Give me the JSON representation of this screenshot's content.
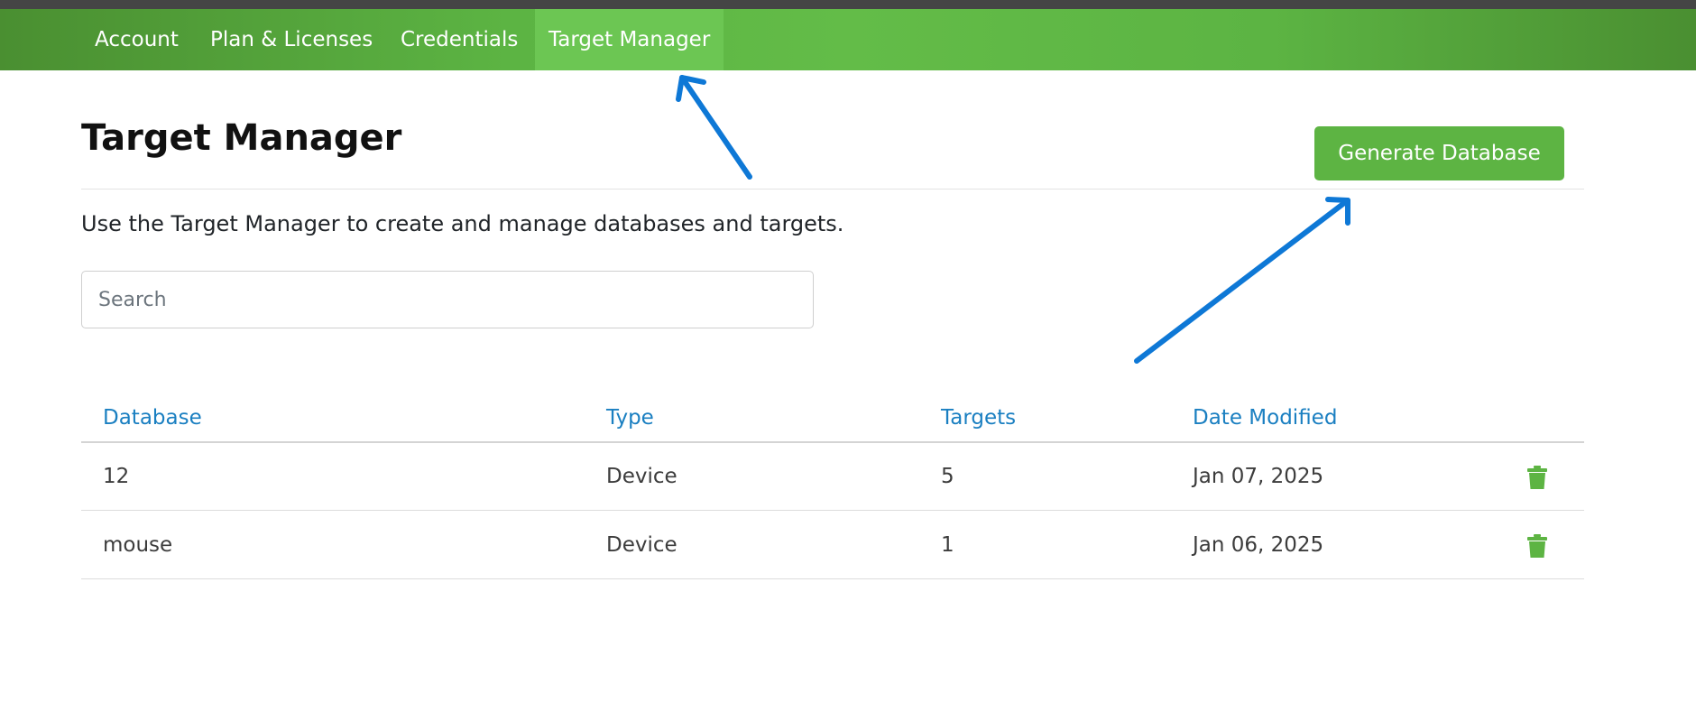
{
  "nav": {
    "items": [
      {
        "label": "Account",
        "active": false
      },
      {
        "label": "Plan & Licenses",
        "active": false
      },
      {
        "label": "Credentials",
        "active": false
      },
      {
        "label": "Target Manager",
        "active": true
      }
    ]
  },
  "page": {
    "title": "Target Manager",
    "description": "Use the Target Manager to create and manage databases and targets.",
    "generate_button": "Generate Database"
  },
  "search": {
    "placeholder": "Search",
    "value": ""
  },
  "table": {
    "columns": [
      "Database",
      "Type",
      "Targets",
      "Date Modified"
    ],
    "rows": [
      {
        "database": "12",
        "type": "Device",
        "targets": "5",
        "date_modified": "Jan 07, 2025"
      },
      {
        "database": "mouse",
        "type": "Device",
        "targets": "1",
        "date_modified": "Jan 06, 2025"
      }
    ]
  },
  "icons": {
    "row_action": "trash-icon",
    "annotation": "arrow-annotation"
  },
  "colors": {
    "nav_green": "#5cb443",
    "active_tab": "#6cc653",
    "button_green": "#5db443",
    "link_blue": "#1a7fc1",
    "trash_green": "#5db443",
    "annotation_blue": "#0e78d6"
  }
}
